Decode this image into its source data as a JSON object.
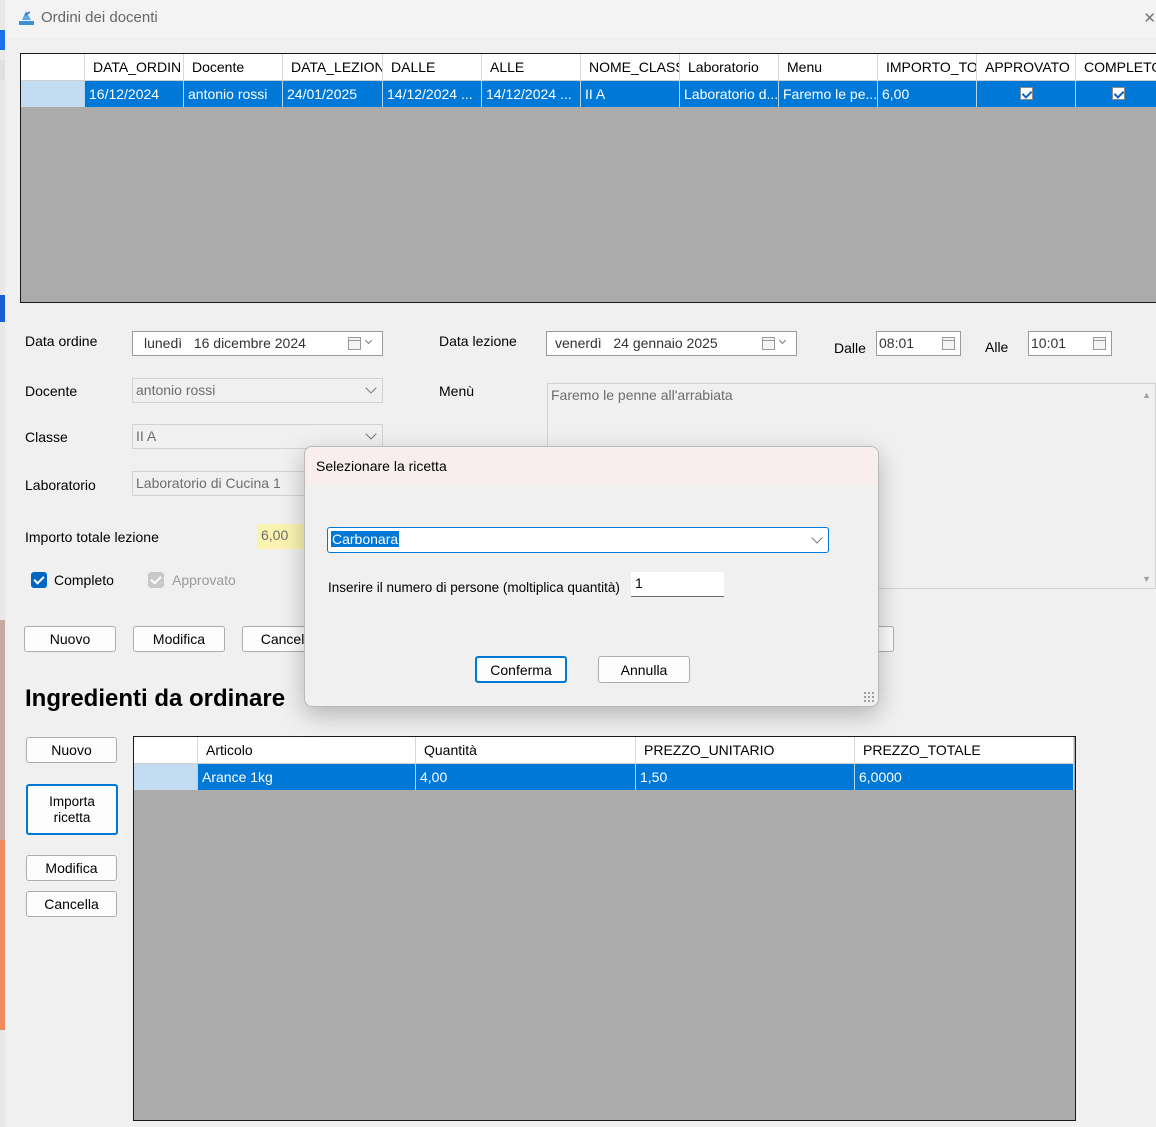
{
  "window": {
    "title": "Ordini dei docenti",
    "close_glyph": "✕"
  },
  "orders_grid": {
    "columns": [
      "",
      "DATA_ORDIN",
      "Docente",
      "DATA_LEZION",
      "DALLE",
      "ALLE",
      "NOME_CLASS",
      "Laboratorio",
      "Menu",
      "IMPORTO_TO",
      "APPROVATO",
      "COMPLETO"
    ],
    "rows": [
      {
        "data_ordine": "16/12/2024",
        "docente": "antonio rossi",
        "data_lezione": "24/01/2025",
        "dalle": "14/12/2024 ...",
        "alle": "14/12/2024 ...",
        "nome_classe": "II A",
        "laboratorio": "Laboratorio d...",
        "menu": "Faremo le pe...",
        "importo": "6,00",
        "approvato": true,
        "completo": true
      }
    ]
  },
  "form": {
    "data_ordine_label": "Data ordine",
    "data_ordine_day": "lunedì",
    "data_ordine_value": "16  dicembre  2024",
    "data_lezione_label": "Data lezione",
    "data_lezione_day": "venerdì",
    "data_lezione_value": "24  gennaio  2025",
    "dalle_label": "Dalle",
    "dalle_value": "08:01",
    "alle_label": "Alle",
    "alle_value": "10:01",
    "docente_label": "Docente",
    "docente_value": "antonio rossi",
    "menu_label": "Menù",
    "menu_value": "Faremo le penne all'arrabiata",
    "classe_label": "Classe",
    "classe_value": "II A",
    "laboratorio_label": "Laboratorio",
    "laboratorio_value": "Laboratorio di Cucina 1",
    "importo_label": "Importo totale lezione",
    "importo_value": "6,00",
    "completo_label": "Completo",
    "completo_checked": true,
    "approvato_label": "Approvato",
    "approvato_checked": true
  },
  "order_buttons": {
    "nuovo": "Nuovo",
    "modifica": "Modifica",
    "cancella": "Cancella"
  },
  "ingredients": {
    "title": "Ingredienti da ordinare",
    "buttons": {
      "nuovo": "Nuovo",
      "importa_line1": "Importa",
      "importa_line2": "ricetta",
      "modifica": "Modifica",
      "cancella": "Cancella"
    },
    "columns": [
      "",
      "Articolo",
      "Quantità",
      "PREZZO_UNITARIO",
      "PREZZO_TOTALE"
    ],
    "rows": [
      {
        "articolo": "Arance 1kg",
        "quantita": "4,00",
        "prezzo_unitario": "1,50",
        "prezzo_totale": "6,0000"
      }
    ]
  },
  "dialog": {
    "title": "Selezionare la ricetta",
    "recipe_selected": "Carbonara",
    "persons_label": "Inserire il numero di persone (moltiplica quantità)",
    "persons_value": "1",
    "confirm": "Conferma",
    "cancel": "Annulla"
  },
  "colors": {
    "accent": "#0078d7",
    "grid_bg": "#ababab",
    "importo_bg": "#fbf3b0"
  }
}
